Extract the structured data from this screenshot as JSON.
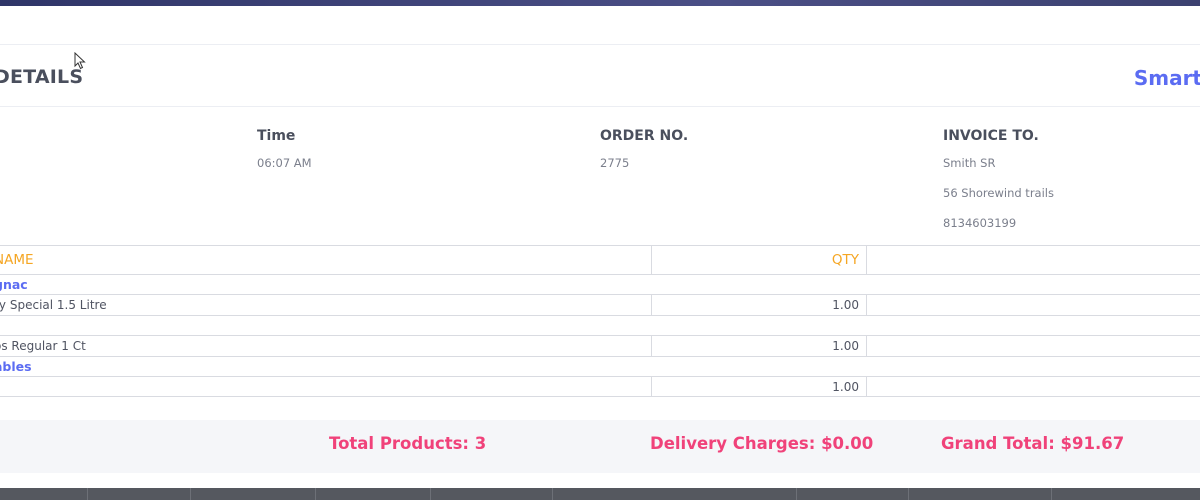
{
  "header": {
    "title": "DETAILS",
    "brand": "Smart"
  },
  "info": {
    "time": {
      "label": "Time",
      "value": "06:07 AM"
    },
    "order": {
      "label": "ORDER NO.",
      "value": "2775"
    },
    "invoice": {
      "label": "INVOICE TO.",
      "name": "Smith SR",
      "address": "56 Shorewind trails",
      "phone": "8134603199"
    }
  },
  "table": {
    "headers": {
      "name": "NAME",
      "qty": "QTY"
    },
    "rows": [
      {
        "type": "category",
        "name": "gnac"
      },
      {
        "type": "item",
        "name": "ry Special 1.5 Litre",
        "qty": "1.00"
      },
      {
        "type": "spacer"
      },
      {
        "type": "item",
        "name": "os Regular 1 Ct",
        "qty": "1.00"
      },
      {
        "type": "category",
        "name": "ables"
      },
      {
        "type": "item",
        "name": "",
        "qty": "1.00"
      }
    ]
  },
  "totals": {
    "products": "Total Products: 3",
    "delivery": "Delivery Charges: $0.00",
    "grand": "Grand Total: $91.67"
  },
  "colors": {
    "accent_blue": "#5b6cf2",
    "header_orange": "#f5a623",
    "total_pink": "#f0427a",
    "text_dark": "#4a4f5d"
  }
}
